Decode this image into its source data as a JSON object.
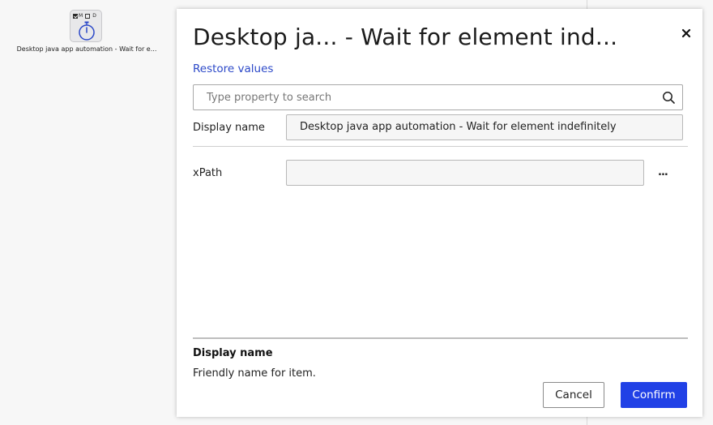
{
  "canvas": {
    "node": {
      "badge_m": "M",
      "badge_d": "D",
      "badge_m_checked": true,
      "badge_d_checked": false,
      "icon": "stopwatch-icon",
      "label": "Desktop java app automation - Wait for e..."
    }
  },
  "dialog": {
    "title": "Desktop ja... - Wait for element ind...",
    "close_icon": "close-icon",
    "restore_label": "Restore values",
    "search": {
      "placeholder": "Type property to search",
      "value": "",
      "icon": "search-icon"
    },
    "properties": [
      {
        "label": "Display name",
        "value": "Desktop java app automation - Wait for element indefinitely"
      },
      {
        "label": "xPath",
        "value": ""
      }
    ],
    "more_label": "...",
    "help": {
      "title": "Display name",
      "text": "Friendly name for item."
    },
    "buttons": {
      "cancel": "Cancel",
      "confirm": "Confirm"
    }
  },
  "colors": {
    "accent": "#2141e6",
    "link": "#2b48c8",
    "node_icon": "#2b48c8"
  }
}
